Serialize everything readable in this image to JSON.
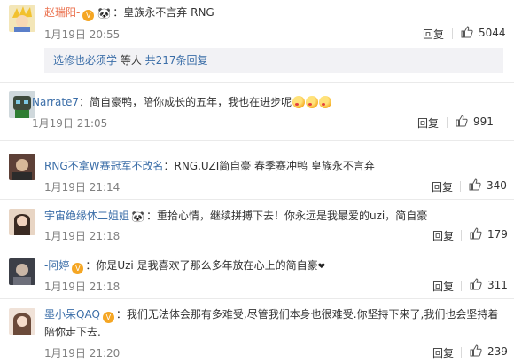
{
  "ui": {
    "reply_label": "回复"
  },
  "comments": [
    {
      "user": "赵瑞阳-",
      "text": "：皇族永不言弃 RNG",
      "time": "1月19日 20:55",
      "likes": "5044",
      "sub": {
        "user": "选修也必须学",
        "mid": " 等人 ",
        "total": "共217条回复"
      }
    },
    {
      "user": "Narrate7",
      "text": "：简自豪鸭，陪你成长的五年，我也在进步呢",
      "time": "1月19日 21:05",
      "likes": "991"
    },
    {
      "user": "RNG不拿W赛冠军不改名",
      "text": "：RNG.UZI简自豪 春季赛冲鸭 皇族永不言弃",
      "time": "1月19日 21:14",
      "likes": "340"
    },
    {
      "user": "宇宙绝缘体二姐姐",
      "text": "：重拾心情，继续拼搏下去！你永远是我最爱的uzi，简自豪",
      "time": "1月19日 21:18",
      "likes": "179"
    },
    {
      "user": "-阿婷",
      "text": "：你是Uzi  是我喜欢了那么多年放在心上的简自豪",
      "time": "1月19日 21:18",
      "likes": "311"
    },
    {
      "user": "墨小呆QAQ",
      "text": "：我们无法体会那有多难受,尽管我们本身也很难受.你坚持下来了,我们也会坚持着",
      "text2": "陪你走下去.",
      "time": "1月19日 21:20",
      "likes": "239"
    }
  ]
}
